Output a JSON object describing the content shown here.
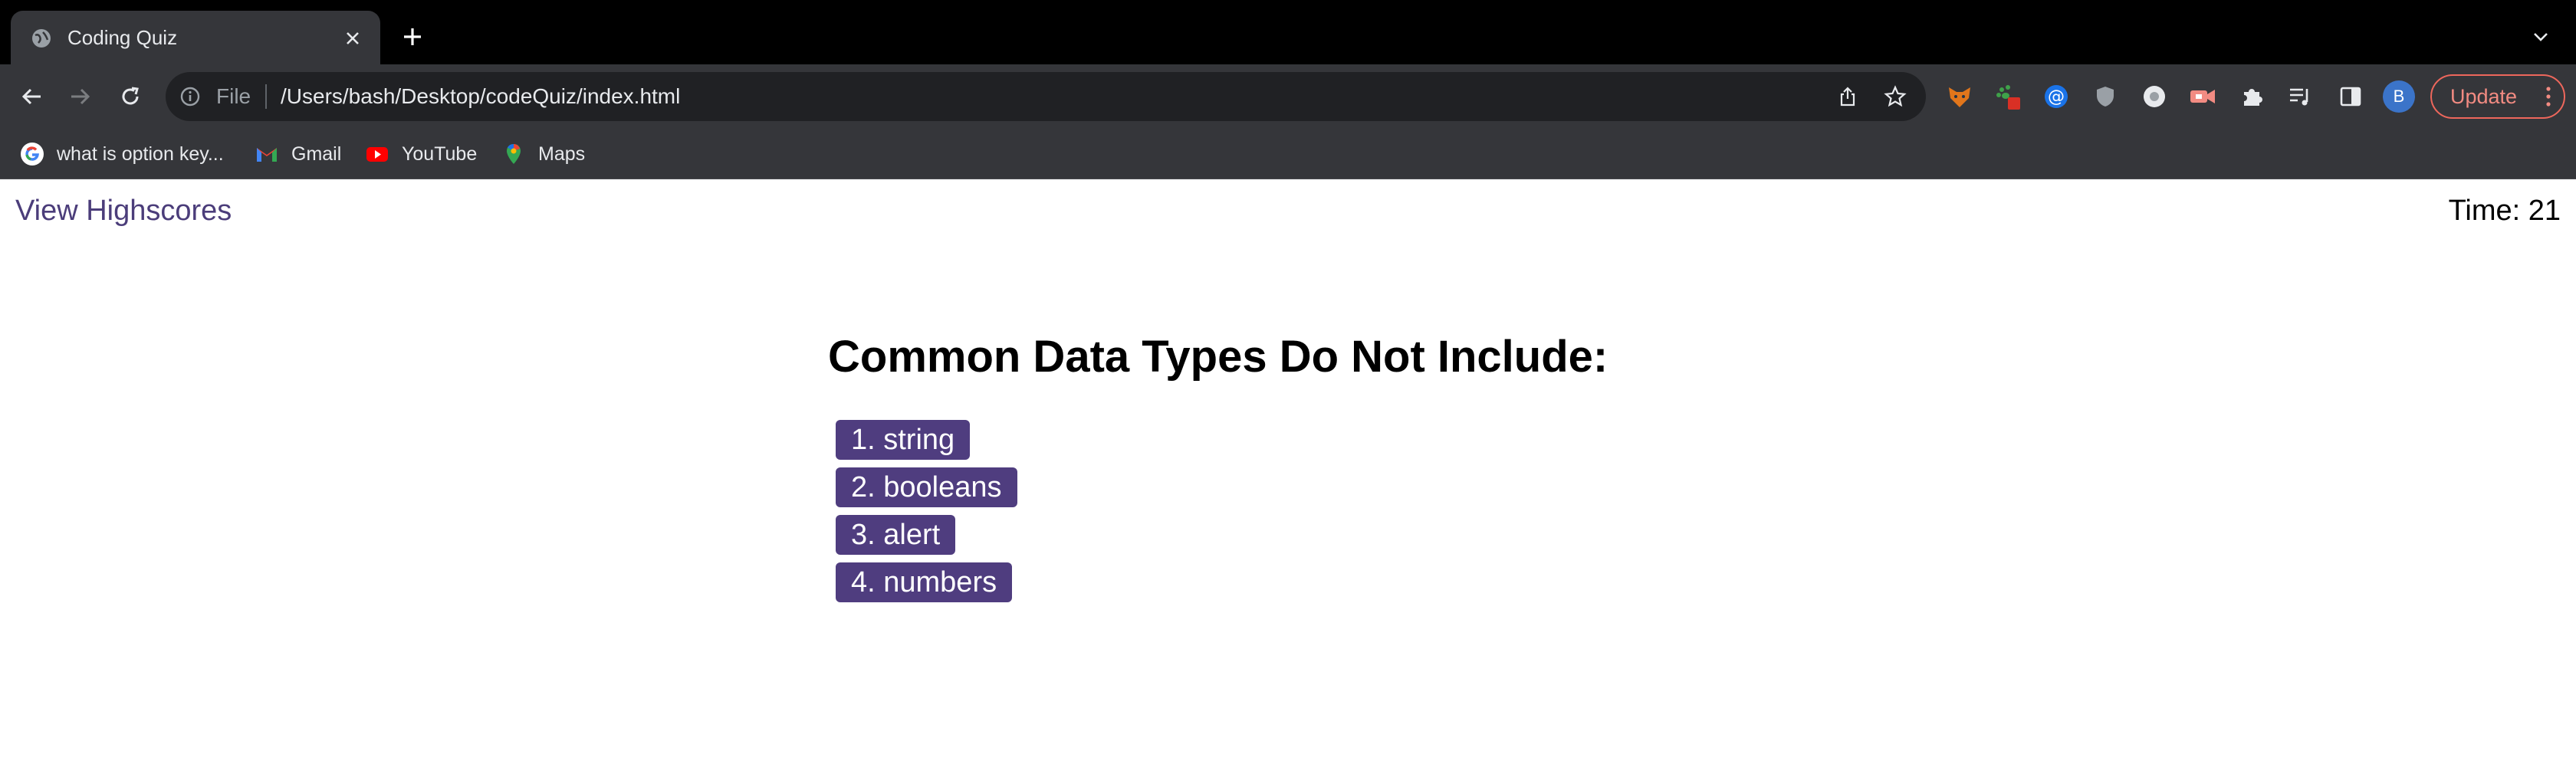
{
  "browser": {
    "tab_title": "Coding Quiz",
    "omnibox_scheme": "File",
    "url": "/Users/bash/Desktop/codeQuiz/index.html",
    "update_label": "Update",
    "avatar_initial": "B",
    "bookmarks": [
      {
        "label": "what is option key...",
        "icon": "google-icon"
      },
      {
        "label": "Gmail",
        "icon": "gmail-icon"
      },
      {
        "label": "YouTube",
        "icon": "youtube-icon"
      },
      {
        "label": "Maps",
        "icon": "maps-icon"
      }
    ]
  },
  "page": {
    "highscores_link": "View Highscores",
    "timer": "Time: 21",
    "question": "Common Data Types Do Not Include:",
    "answers": [
      "1. string",
      "2. booleans",
      "3. alert",
      "4. numbers"
    ]
  },
  "colors": {
    "accent": "#4f3d7f",
    "link": "#4b3d7a",
    "update": "#f28b82"
  }
}
